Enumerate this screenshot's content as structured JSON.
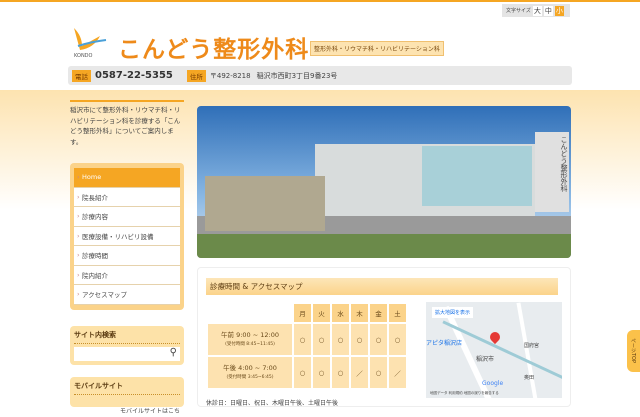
{
  "font_size": {
    "label": "文字サイズ",
    "options": [
      "大",
      "中",
      "小"
    ],
    "selected": "小"
  },
  "header": {
    "logo_text": "KONDO",
    "title": "こんどう整形外科",
    "tagline": "整形外科・リウマチ科・リハビリテーション科",
    "tel_label": "電話",
    "tel": "0587-22-5355",
    "addr_label": "住所",
    "postal": "〒492-8218",
    "address": "稲沢市西町3丁目9番23号"
  },
  "sidebar": {
    "intro": "稲沢市にて整形外科・リウマチ科・リハビリテーション科を診療する「こんどう整形外科」についてご案内します。",
    "nav": [
      "Home",
      "院長紹介",
      "診療内容",
      "医療設備・リハビリ設備",
      "診療時間",
      "院内紹介",
      "アクセスマップ"
    ],
    "search_title": "サイト内検索",
    "mobile_title": "モバイルサイト",
    "mobile_text": "モバイルサイトはこち"
  },
  "photo": {
    "sign": "こんどう整形外科"
  },
  "access": {
    "title": "診療時間 & アクセスマップ",
    "days": [
      "月",
      "火",
      "水",
      "木",
      "金",
      "土"
    ],
    "rows": [
      {
        "time": "午前 9:00 ~ 12:00",
        "reception": "(受付時間 8:45~11:45)",
        "marks": [
          "○",
          "○",
          "○",
          "○",
          "○",
          "○"
        ]
      },
      {
        "time": "午後 4:00 ~ 7:00",
        "reception": "(受付時間 3:45~6:45)",
        "marks": [
          "○",
          "○",
          "○",
          "／",
          "○",
          "／"
        ]
      }
    ],
    "closed": "休診日：日曜日、祝日、木曜日午後、土曜日午後",
    "map": {
      "enlarge": "拡大地図を表示",
      "store": "アピタ稲沢店",
      "city": "稲沢市",
      "place1": "国府宮",
      "place2": "奥田",
      "footer": "地図データ 利用規約 地図の誤りを報告する",
      "brand": "Google"
    }
  },
  "page_top": "ページTOP"
}
